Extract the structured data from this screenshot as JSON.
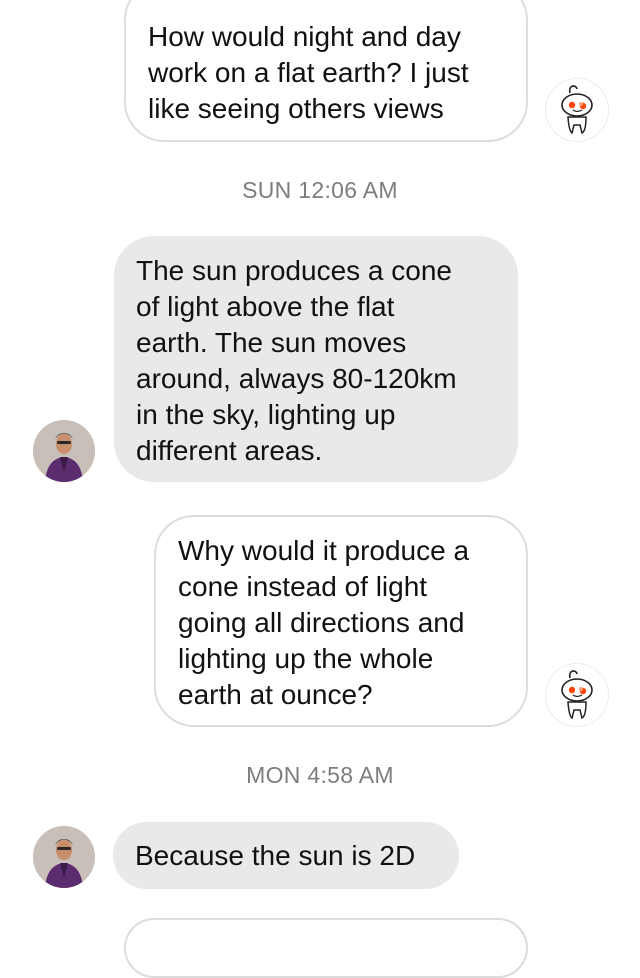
{
  "colors": {
    "incoming_bubble": "#e9e9eb",
    "outgoing_bubble": "#ffffff",
    "outgoing_border": "#dcdcdc",
    "timestamp": "#7d7d7d",
    "snoo_accent": "#ff4500"
  },
  "messages": [
    {
      "sender": "me",
      "avatar_icon": "snoo-avatar-icon",
      "text": "How would night and day\nwork on a flat earth? I just\nlike seeing others views"
    },
    {
      "type": "timestamp",
      "text": "SUN 12:06 AM"
    },
    {
      "sender": "them",
      "avatar_icon": "person-avatar-icon",
      "text": "The sun produces a cone\nof light above the flat\nearth. The sun moves\naround, always 80-120km\nin the sky, lighting up\ndifferent areas."
    },
    {
      "sender": "me",
      "avatar_icon": "snoo-avatar-icon",
      "text": "Why would it produce a\ncone instead of light\ngoing all directions and\nlighting up the whole\nearth at ounce?"
    },
    {
      "type": "timestamp",
      "text": "MON 4:58 AM"
    },
    {
      "sender": "them",
      "avatar_icon": "person-avatar-icon",
      "text": "Because the sun is 2D"
    }
  ]
}
